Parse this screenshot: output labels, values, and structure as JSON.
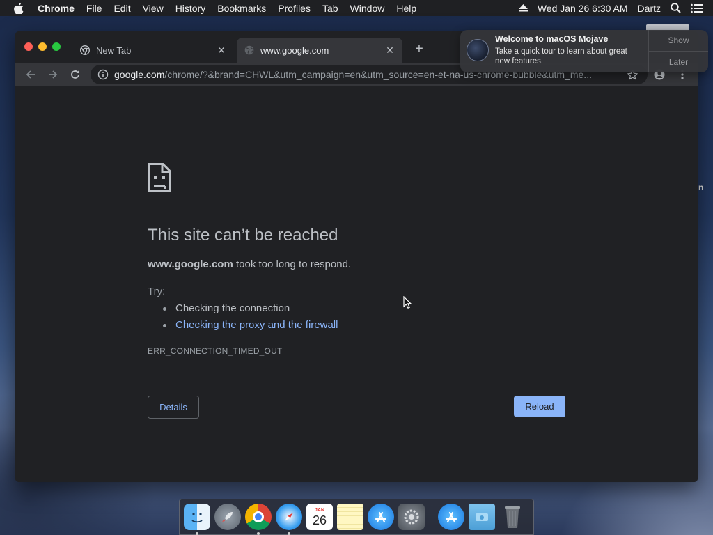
{
  "menubar": {
    "app": "Chrome",
    "items": [
      "File",
      "Edit",
      "View",
      "History",
      "Bookmarks",
      "Profiles",
      "Tab",
      "Window",
      "Help"
    ],
    "datetime": "Wed Jan 26  6:30 AM",
    "user": "Dartz"
  },
  "browser": {
    "tabs": [
      {
        "title": "New Tab",
        "active": false
      },
      {
        "title": "www.google.com",
        "active": true
      }
    ],
    "url_host": "google.com",
    "url_path": "/chrome/?&brand=CHWL&utm_campaign=en&utm_source=en-et-na-us-chrome-bubble&utm_me..."
  },
  "error_page": {
    "title": "This site can’t be reached",
    "host": "www.google.com",
    "message": " took too long to respond.",
    "try_label": "Try:",
    "suggestions": [
      {
        "text": "Checking the connection",
        "link": false
      },
      {
        "text": "Checking the proxy and the firewall",
        "link": true
      }
    ],
    "error_code": "ERR_CONNECTION_TIMED_OUT",
    "details_button": "Details",
    "reload_button": "Reload"
  },
  "notification": {
    "title": "Welcome to macOS Mojave",
    "body": "Take a quick tour to learn about great new features.",
    "show_label": "Show",
    "later_label": "Later"
  },
  "desktop": {
    "side_text": "n"
  },
  "dock": {
    "calendar_month": "JAN",
    "calendar_day": "26"
  },
  "colors": {
    "link": "#8ab4f8",
    "page_bg": "#202124",
    "toolbar_bg": "#35363a"
  }
}
